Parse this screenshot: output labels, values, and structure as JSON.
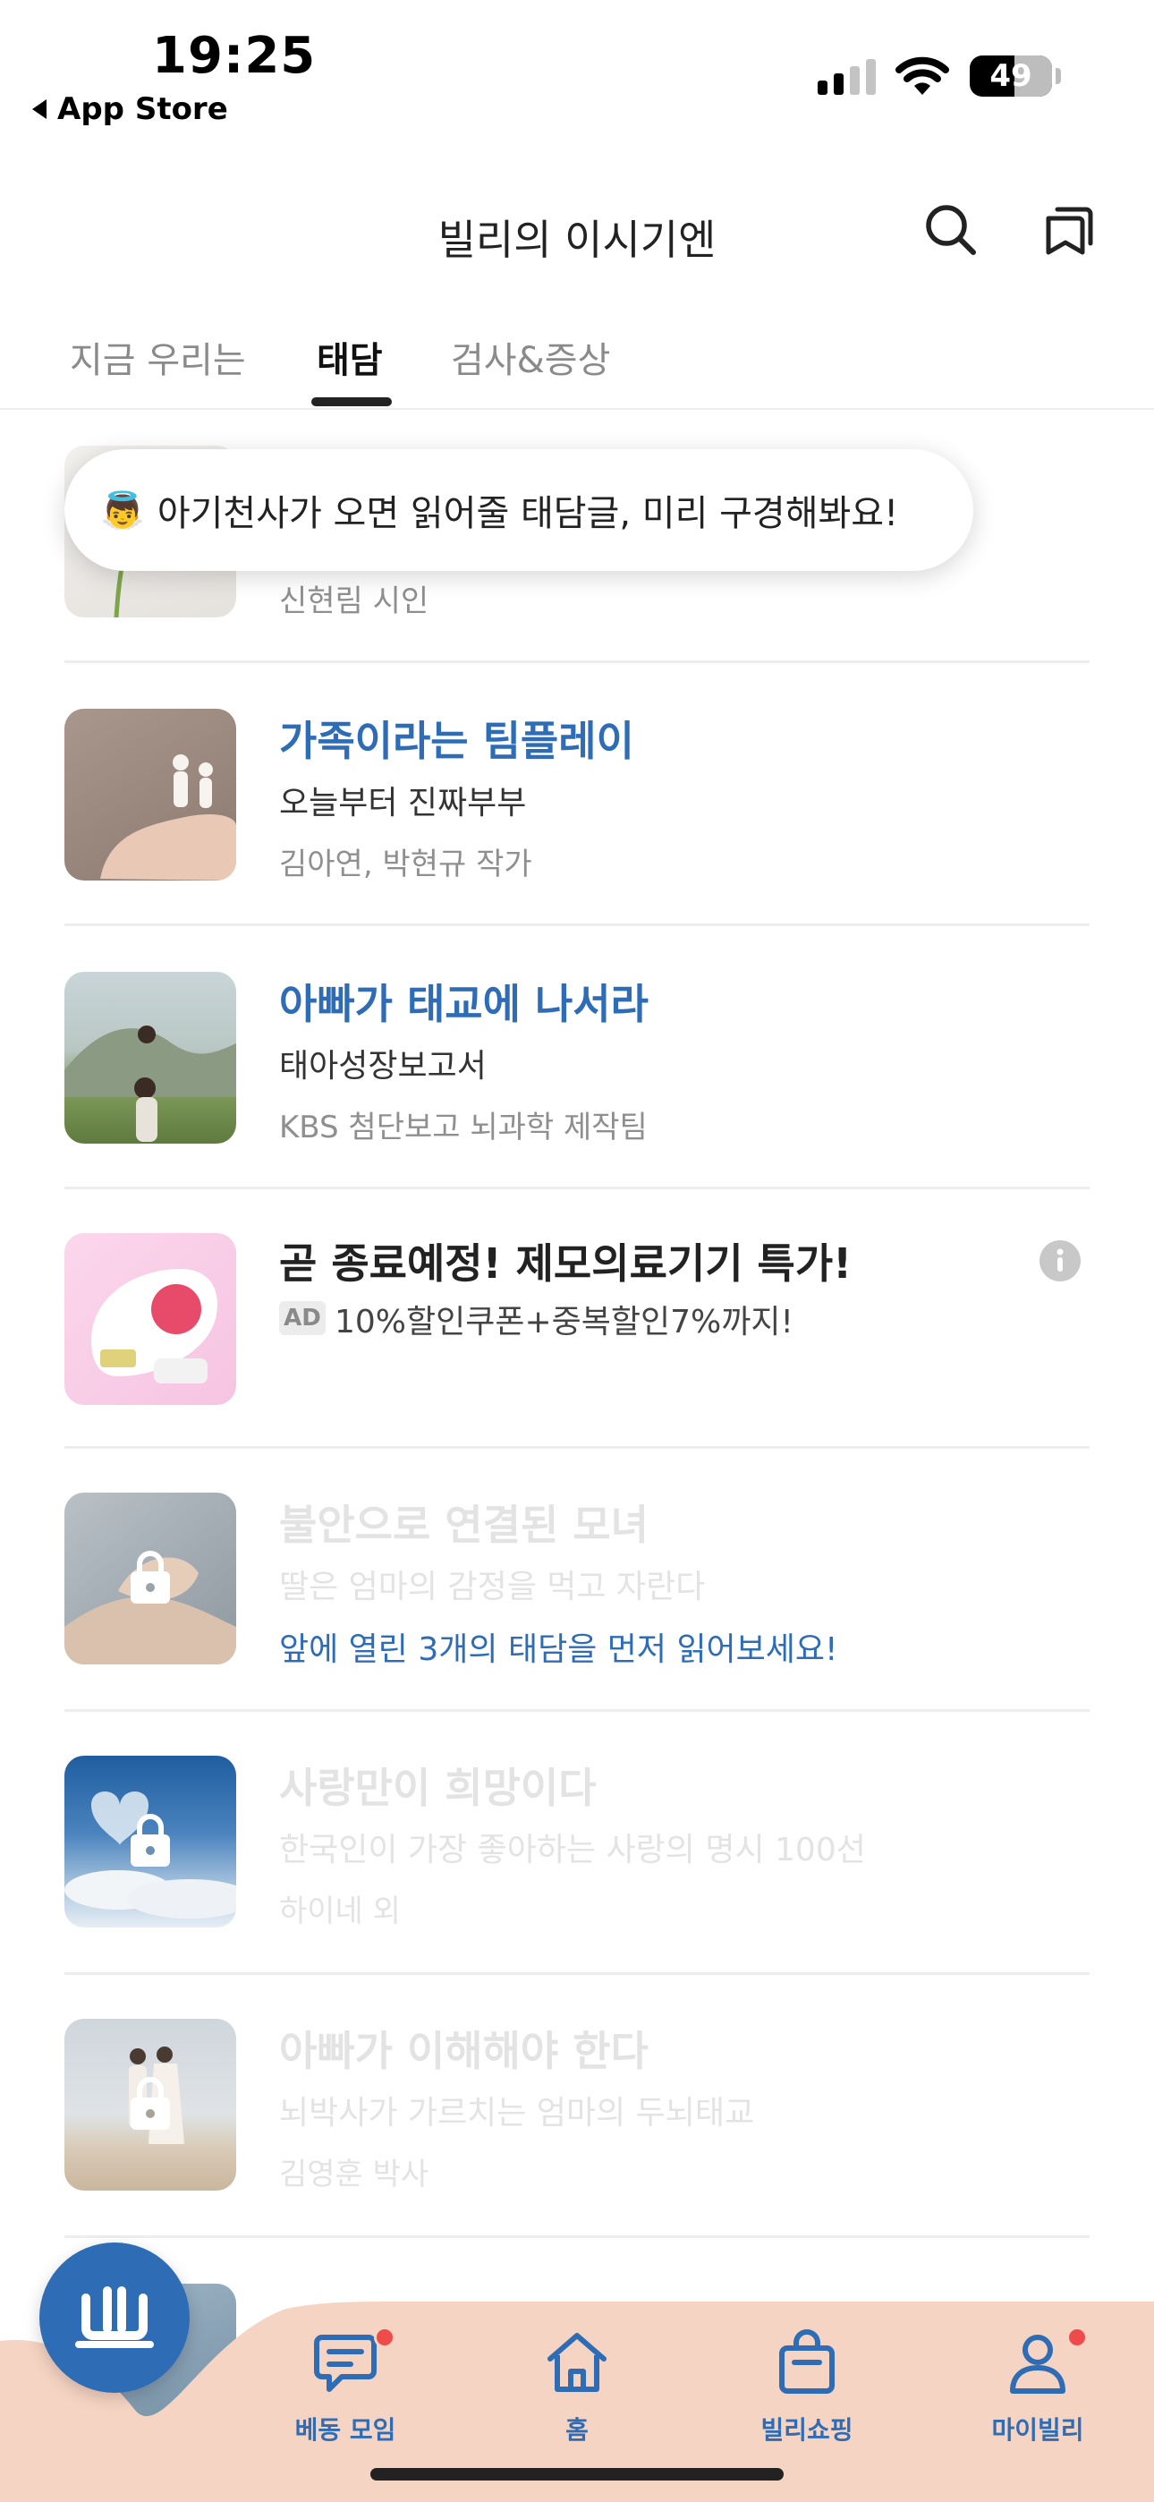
{
  "status_bar": {
    "time": "19:25",
    "back_label": "App Store",
    "battery": "49"
  },
  "header": {
    "title": "빌리의 이시기엔",
    "icons": [
      "search-icon",
      "bookmark-icon"
    ]
  },
  "tabs": [
    {
      "label": "지금 우리는",
      "active": false
    },
    {
      "label": "태담",
      "active": true
    },
    {
      "label": "검사&증상",
      "active": false
    }
  ],
  "tooltip": {
    "emoji": "👼",
    "text": "아기천사가 오면 읽어줄 태담글, 미리 구경해봐요!"
  },
  "items": [
    {
      "author": "신현림 시인"
    },
    {
      "title": "가족이라는 팀플레이",
      "subtitle": "오늘부터 진짜부부",
      "author": "김아연, 박현규 작가"
    },
    {
      "title": "아빠가 태교에 나서라",
      "subtitle": "태아성장보고서",
      "author": "KBS 첨단보고 뇌과학 제작팀"
    },
    {
      "title": "불안으로 연결된 모녀",
      "subtitle": "딸은 엄마의 감정을 먹고 자란다",
      "locked": true
    },
    {
      "title": "사랑만이 희망이다",
      "subtitle": "한국인이 가장 좋아하는 사랑의 명시 100선",
      "author": "하이네 외",
      "locked": true
    },
    {
      "title": "아빠가 이해해야 한다",
      "subtitle": "뇌박사가 가르치는 엄마의 두뇌태교",
      "author": "김영훈 박사",
      "locked": true
    }
  ],
  "unlock_hint": "앞에 열린 3개의 태담을 먼저 읽어보세요!",
  "ad": {
    "title": "곧 종료예정! 제모의료기기 특가!",
    "badge": "AD",
    "text": "10%할인쿠폰+중복할인7%까지!"
  },
  "bottom_nav": [
    {
      "label": "베동 모임",
      "icon": "chat-icon",
      "dot": true
    },
    {
      "label": "홈",
      "icon": "home-icon",
      "dot": false
    },
    {
      "label": "빌리쇼핑",
      "icon": "shopping-bag-icon",
      "dot": false
    },
    {
      "label": "마이빌리",
      "icon": "person-icon",
      "dot": true
    }
  ],
  "colors": {
    "accent": "#2e6db6",
    "bottom_bar": "#f6d4c3",
    "notification_dot": "#ef4b4b"
  }
}
